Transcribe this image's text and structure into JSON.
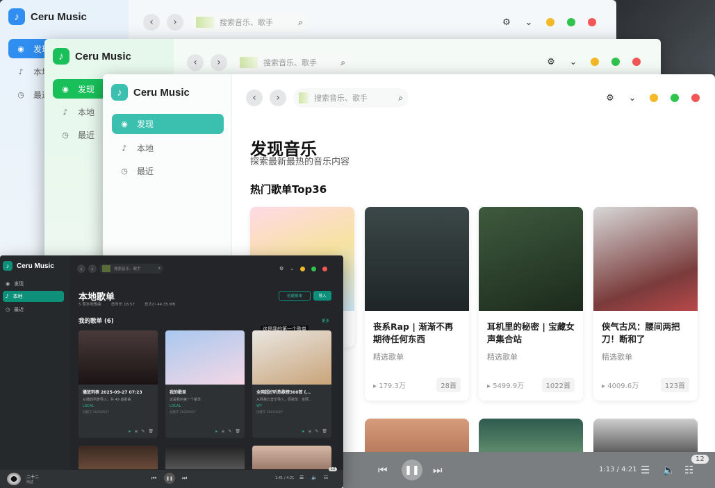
{
  "app": {
    "name": "Ceru Music"
  },
  "nav": {
    "discover": "发现",
    "local": "本地",
    "recent": "最近"
  },
  "search": {
    "placeholder": "搜索音乐、歌手"
  },
  "back": {
    "win1_partial_discover": "发现",
    "win1_partial_local": "本地",
    "win1_partial_recent": "最近"
  },
  "discover": {
    "title": "发现音乐",
    "subtitle": "探索最新最热的音乐内容",
    "section": "热门歌单Top36",
    "cards": [
      {
        "title": "",
        "tag": "",
        "plays": "",
        "count": ""
      },
      {
        "title": "丧系Rap | 渐渐不再期待任何东西",
        "tag": "精选歌单",
        "plays": "179.3万",
        "count": "28首"
      },
      {
        "title": "耳机里的秘密 | 宝藏女声集合站",
        "tag": "精选歌单",
        "plays": "5499.9万",
        "count": "1022首"
      },
      {
        "title": "侠气古风：腰间两把刀！断和了",
        "tag": "精选歌单",
        "plays": "4009.6万",
        "count": "123首"
      }
    ]
  },
  "player": {
    "time": "1:13 / 4:21",
    "queue_count": "12"
  },
  "local": {
    "title": "本地歌单",
    "meta": [
      "5 首本地歌曲",
      "总时长 18:57",
      "总大小 44.35 MB"
    ],
    "btn_create": "创建歌单",
    "btn_import": "导入",
    "section": "我的歌单 (6)",
    "more": "更多",
    "cards": [
      {
        "title": "播放列表 2025-09-27 07:23",
        "desc": "从播放列表导入，共 49 首歌曲",
        "src": "LOCAL",
        "created": "创建于 2025/9/27"
      },
      {
        "title": "我的歌单",
        "desc": "这是我的第一个歌单",
        "src": "LOCAL",
        "created": "创建于 2025/9/27"
      },
      {
        "title": "全网超好听热歌榜300首 (...",
        "desc": "从网易云音乐导入，原歌单：全网...",
        "src": "WY",
        "created": "创建于 2025/9/27"
      }
    ],
    "overlay_text": "这是我的第一个歌单",
    "player": {
      "song": "二十二",
      "artist": "陶喆",
      "time": "1:41 / 4:21",
      "queue_count": "12"
    }
  },
  "colors": {
    "teal": "#3bbfae",
    "green": "#19c05a",
    "blue": "#2f8ef0",
    "dark_accent": "#0e8f7a"
  },
  "icons": [
    "music-note-icon",
    "compass-icon",
    "note-icon",
    "clock-icon",
    "chevron-left-icon",
    "chevron-right-icon",
    "search-icon",
    "gear-icon",
    "chevron-down-circle-icon",
    "prev-icon",
    "pause-icon",
    "next-icon",
    "playlist-icon",
    "volume-icon",
    "queue-icon"
  ]
}
